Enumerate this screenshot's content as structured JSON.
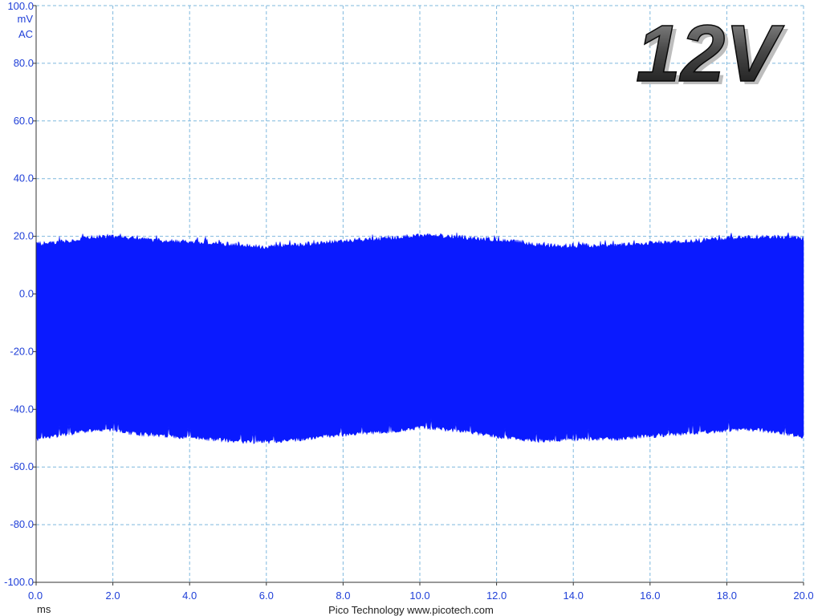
{
  "chart_data": {
    "type": "area",
    "x": [
      0.0,
      0.5,
      1.0,
      1.5,
      2.0,
      2.5,
      3.0,
      3.5,
      4.0,
      4.5,
      5.0,
      5.5,
      6.0,
      6.5,
      7.0,
      7.5,
      8.0,
      8.5,
      9.0,
      9.5,
      10.0,
      10.5,
      11.0,
      11.5,
      12.0,
      12.5,
      13.0,
      13.5,
      14.0,
      14.5,
      15.0,
      15.5,
      16.0,
      16.5,
      17.0,
      17.5,
      18.0,
      18.5,
      19.0,
      19.5,
      20.0
    ],
    "series": [
      {
        "upper": [
          17,
          17.5,
          18.5,
          19.5,
          19.5,
          19,
          18.5,
          18,
          18,
          17.5,
          17,
          16.5,
          16,
          16.5,
          17,
          17.5,
          18,
          18.5,
          19,
          19.5,
          20,
          20,
          19.5,
          19,
          18.5,
          18,
          17,
          16.5,
          16.5,
          16.5,
          16.5,
          17,
          17.5,
          17.5,
          18,
          18.5,
          19,
          19.5,
          19.5,
          19.5,
          19
        ],
        "lower": [
          -50,
          -49,
          -48,
          -47,
          -47,
          -48,
          -48.5,
          -49,
          -49.5,
          -50,
          -50.5,
          -51,
          -51,
          -50.5,
          -50,
          -49,
          -48.5,
          -48,
          -47.5,
          -47,
          -46,
          -46.5,
          -47,
          -48,
          -49,
          -50,
          -50.5,
          -50.5,
          -50,
          -50,
          -50,
          -49.5,
          -49,
          -48.5,
          -48,
          -47.5,
          -47,
          -46.5,
          -47,
          -48,
          -49.5
        ]
      }
    ],
    "xlim": [
      0,
      20
    ],
    "ylim": [
      -100,
      100
    ],
    "xticks": [
      "0.0",
      "2.0",
      "4.0",
      "6.0",
      "8.0",
      "10.0",
      "12.0",
      "14.0",
      "16.0",
      "18.0",
      "20.0"
    ],
    "yticks": [
      "100.0",
      "80.0",
      "60.0",
      "40.0",
      "20.0",
      "0.0",
      "-20.0",
      "-40.0",
      "-60.0",
      "-80.0",
      "-100.0"
    ],
    "xlabel": "ms",
    "ylabel": "mV",
    "coupling": "AC",
    "footer": "Pico Technology  www.picotech.com",
    "badge": "12V",
    "grid": true,
    "colors": {
      "trace": "#0a1aff",
      "grid": "#7fb8de",
      "tick_text": "#1f3fd8"
    }
  }
}
